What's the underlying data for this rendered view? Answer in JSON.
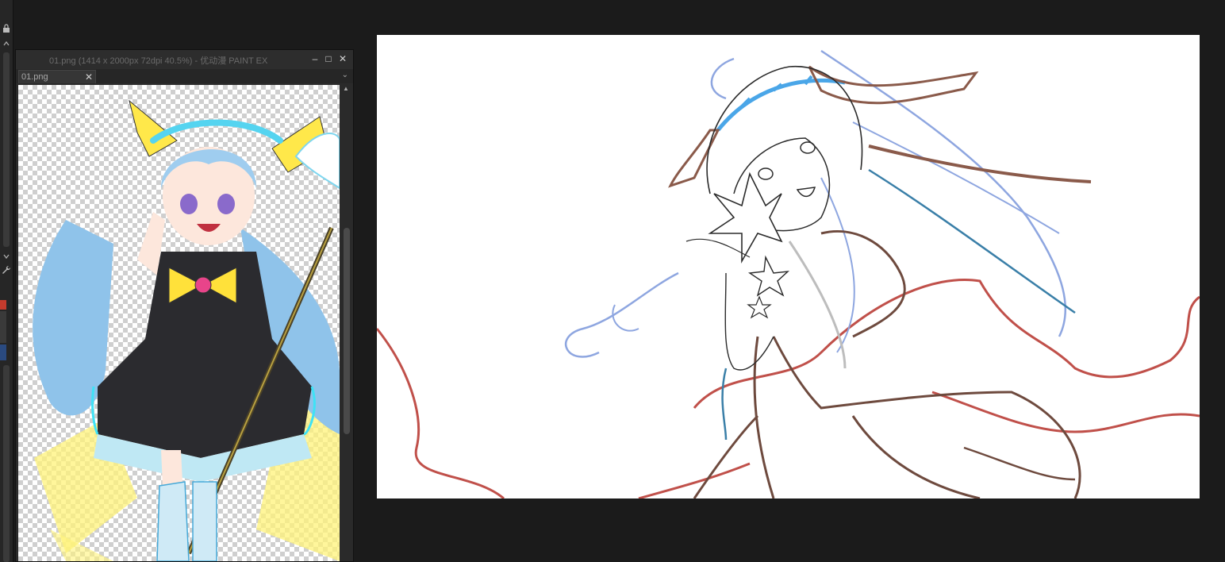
{
  "left_strip": {
    "icons": [
      "lock-icon",
      "chevron-up-icon",
      "chevron-down-icon",
      "wrench-icon"
    ]
  },
  "subwindow": {
    "title": "01.png (1414 x 2000px 72dpi 40.5%)  - 优动漫 PAINT EX",
    "minimize": "–",
    "maximize": "□",
    "close": "✕",
    "tab": {
      "label": "01.png",
      "close": "✕"
    },
    "tab_dropdown": "⌄"
  },
  "colors": {
    "background": "#1b1b1b",
    "panel": "#2a2a2a",
    "canvas": "#ffffff",
    "sketch_black": "#2b2b2b",
    "sketch_blue": "#8ea6e0",
    "sketch_red": "#c0504a",
    "sketch_brown": "#8a5a4a",
    "hair_cyan": "#7ec8e8",
    "ribbon_yellow": "#ffe84a"
  }
}
